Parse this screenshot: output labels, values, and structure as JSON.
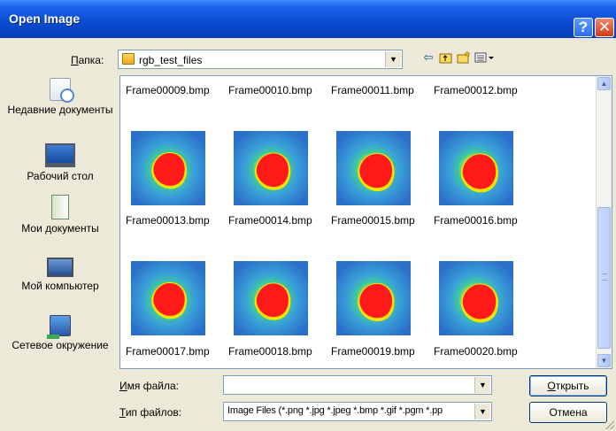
{
  "window": {
    "title": "Open Image",
    "help_glyph": "?",
    "close_glyph": "✕"
  },
  "lookin": {
    "label_prefix": "П",
    "label_rest": "апка:",
    "value": "rgb_test_files"
  },
  "places": [
    {
      "name": "place-recent",
      "icon": "recent-documents-icon",
      "label": "Недавние документы"
    },
    {
      "name": "place-desktop",
      "icon": "desktop-icon",
      "label": "Рабочий стол"
    },
    {
      "name": "place-mydocs",
      "icon": "my-documents-icon",
      "label": "Мои документы"
    },
    {
      "name": "place-mycomputer",
      "icon": "my-computer-icon",
      "label": "Мой компьютер"
    },
    {
      "name": "place-network",
      "icon": "network-icon",
      "label": "Сетевое окружение"
    }
  ],
  "files": {
    "row1_names": [
      "Frame00009.bmp",
      "Frame00010.bmp",
      "Frame00011.bmp",
      "Frame00012.bmp"
    ],
    "row2_names": [
      "Frame00013.bmp",
      "Frame00014.bmp",
      "Frame00015.bmp",
      "Frame00016.bmp"
    ],
    "row3_names": [
      "Frame00017.bmp",
      "Frame00018.bmp",
      "Frame00019.bmp",
      "Frame00020.bmp"
    ]
  },
  "filename": {
    "label_prefix": "И",
    "label_rest": "мя файла:",
    "value": ""
  },
  "filetype": {
    "label_prefix": "Т",
    "label_rest": "ип файлов:",
    "value": "Image Files (*.png *.jpg *.jpeg *.bmp *.gif *.pgm *.pp"
  },
  "buttons": {
    "open_prefix": "О",
    "open_rest": "ткрыть",
    "cancel": "Отмена"
  },
  "colors": {
    "titlebar": "#0a4ad0",
    "heatmap_blue": "#2a6fc8",
    "heatmap_hot": "#ff1a1a"
  }
}
